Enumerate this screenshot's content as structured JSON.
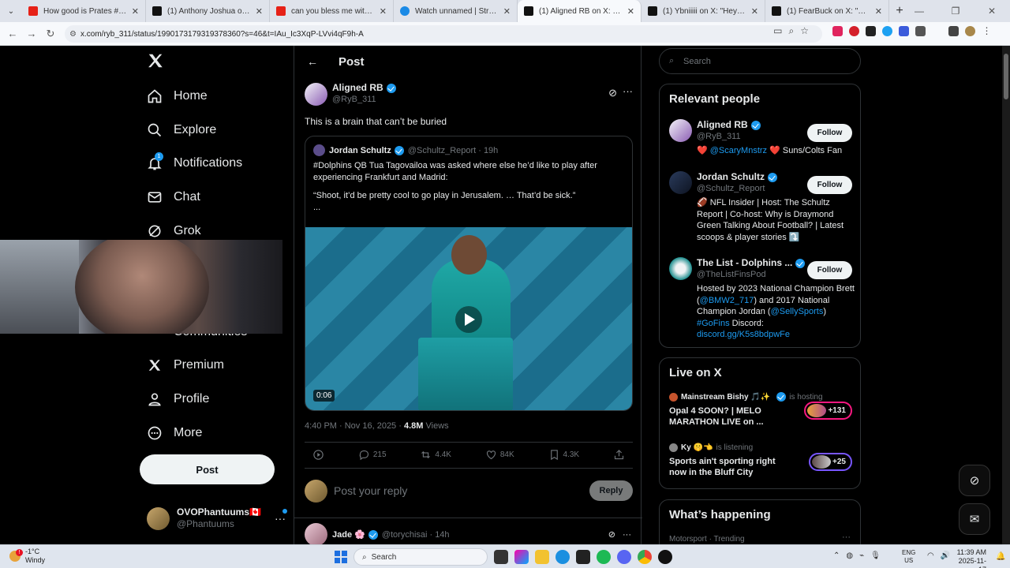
{
  "browser": {
    "tabs": [
      {
        "title": "How good is Prates #ufc322 - Y",
        "icon": "youtube-icon",
        "active": false
      },
      {
        "title": "(1) Anthony Joshua on X: \"He's",
        "icon": "x-icon",
        "active": false
      },
      {
        "title": "can you bless me with someth",
        "icon": "youtube-icon",
        "active": false
      },
      {
        "title": "Watch unnamed | Streamable",
        "icon": "streamable-icon",
        "active": false
      },
      {
        "title": "(1) Aligned RB on X: \"This is a t",
        "icon": "x-icon",
        "active": true
      },
      {
        "title": "(1) Ybniiiii on X: \"Hey everyone",
        "icon": "x-icon",
        "active": false
      },
      {
        "title": "(1) FearBuck on X: \"Cuffem wa",
        "icon": "x-icon",
        "active": false
      }
    ],
    "url": "x.com/ryb_311/status/1990173179319378360?s=46&t=IAu_Ic3XqP-LVvi4qF9h-A"
  },
  "nav": {
    "items": [
      {
        "label": "Home",
        "icon": "home-icon"
      },
      {
        "label": "Explore",
        "icon": "search-icon"
      },
      {
        "label": "Notifications",
        "icon": "bell-icon",
        "badge": "1"
      },
      {
        "label": "Chat",
        "icon": "mail-icon"
      },
      {
        "label": "Grok",
        "icon": "grok-icon"
      },
      {
        "label": "Communities",
        "icon": "communities-icon"
      },
      {
        "label": "Premium",
        "icon": "x-icon"
      },
      {
        "label": "Profile",
        "icon": "person-icon"
      },
      {
        "label": "More",
        "icon": "more-circle-icon"
      }
    ],
    "post_button": "Post",
    "account": {
      "name": "OVOPhantuums🇨🇦",
      "handle": "@Phantuums"
    }
  },
  "main": {
    "header": "Post",
    "post": {
      "author": "Aligned RB",
      "handle": "@RyB_311",
      "text": "This is a brain that can’t be buried",
      "quote": {
        "author": "Jordan Schultz",
        "handle": "@Schultz_Report",
        "time": "· 19h",
        "p1": "#Dolphins QB Tua Tagovailoa was asked where else he’d like to play after experiencing Frankfurt and Madrid:",
        "p2": "“Shoot, it’d be pretty cool to go play in Jerusalem. … That’d be sick.”",
        "p3": "...",
        "video_duration": "0:06"
      },
      "timestamp": "4:40 PM · Nov 16, 2025 ·",
      "views": "4.8M",
      "views_label": "Views",
      "stats": {
        "replies": "215",
        "reposts": "4.4K",
        "likes": "84K",
        "bookmarks": "4.3K"
      }
    },
    "reply": {
      "placeholder": "Post your reply",
      "button": "Reply"
    },
    "next_post": {
      "author": "Jade 🌸",
      "handle": "@torychisai",
      "time": "· 14h"
    }
  },
  "sidebar": {
    "search_placeholder": "Search",
    "relevant": {
      "title": "Relevant people",
      "people": [
        {
          "name": "Aligned RB",
          "handle": "@RyB_311",
          "follow": "Follow",
          "bio_pre": "❤️ ",
          "bio_link": "@ScaryMnstrz",
          "bio_post": " ❤️ Suns/Colts Fan"
        },
        {
          "name": "Jordan Schultz",
          "handle": "@Schultz_Report",
          "follow": "Follow",
          "bio": "🏈 NFL Insider | Host: The Schultz Report | Co-host: Why is Draymond Green Talking About Football? | Latest scoops & player stories ⤵️"
        },
        {
          "name": "The List - Dolphins ...",
          "handle": "@TheListFinsPod",
          "follow": "Follow",
          "bio_a": "Hosted by 2023 National Champion Brett (",
          "bio_l1": "@BMW2_717",
          "bio_b": ") and 2017 National Champion Jordan (",
          "bio_l2": "@SellySports",
          "bio_c": ")",
          "bio_l3": "#GoFins",
          "bio_d": " Discord:",
          "bio_l4": "discord.gg/K5s8bdpwFe"
        }
      ]
    },
    "live": {
      "title": "Live on X",
      "items": [
        {
          "host": "Mainstream Bishy 🎵✨",
          "status": "is hosting",
          "title": "Opal 4 SOON? | MELO MARATHON LIVE on ...",
          "count": "+131"
        },
        {
          "host": "Ky 🤫👈",
          "status": "is listening",
          "title": "Sports ain't sporting right now in the Bluff City",
          "count": "+25"
        }
      ]
    },
    "happening": {
      "title": "What’s happening",
      "sub": "Motorsport · Trending"
    }
  },
  "taskbar": {
    "temp": "-1°C",
    "weather": "Windy",
    "search": "Search",
    "lang1": "ENG",
    "lang2": "US",
    "time": "11:39 AM",
    "date": "2025-11-17"
  }
}
